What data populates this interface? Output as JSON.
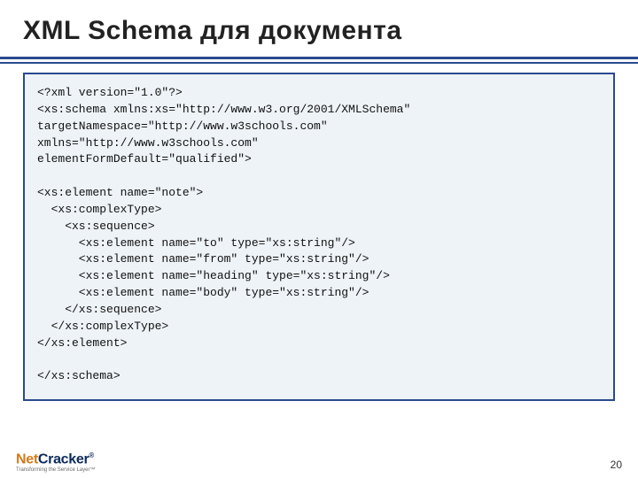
{
  "title": "XML Schema для документа",
  "code": "<?xml version=\"1.0\"?>\n<xs:schema xmlns:xs=\"http://www.w3.org/2001/XMLSchema\"\ntargetNamespace=\"http://www.w3schools.com\"\nxmlns=\"http://www.w3schools.com\"\nelementFormDefault=\"qualified\">\n\n<xs:element name=\"note\">\n  <xs:complexType>\n    <xs:sequence>\n      <xs:element name=\"to\" type=\"xs:string\"/>\n      <xs:element name=\"from\" type=\"xs:string\"/>\n      <xs:element name=\"heading\" type=\"xs:string\"/>\n      <xs:element name=\"body\" type=\"xs:string\"/>\n    </xs:sequence>\n  </xs:complexType>\n</xs:element>\n\n</xs:schema>",
  "footer": {
    "logo_main_prefix": "Net",
    "logo_main_suffix": "Cracker",
    "logo_reg": "®",
    "logo_sub": "Transforming the Service Layer™"
  },
  "page_number": "20"
}
